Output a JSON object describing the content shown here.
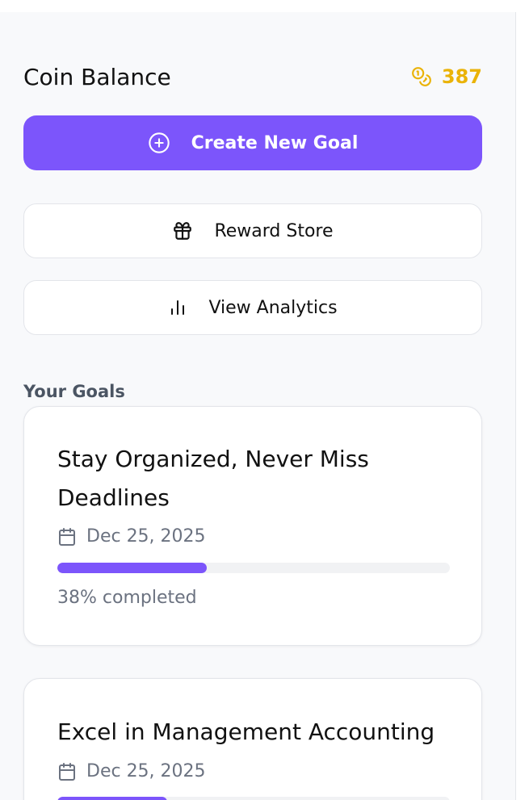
{
  "balance": {
    "title": "Coin Balance",
    "amount": "387",
    "icon": "coins-icon",
    "accent_color": "#eab308"
  },
  "actions": {
    "create_label": "Create New Goal",
    "create_icon": "plus-circle-icon",
    "store_label": "Reward Store",
    "store_icon": "gift-icon",
    "analytics_label": "View Analytics",
    "analytics_icon": "bar-chart-icon"
  },
  "goals_section": {
    "title": "Your Goals"
  },
  "goals": [
    {
      "title": "Stay Organized, Never Miss Deadlines",
      "date": "Dec 25, 2025",
      "progress": 0.38,
      "progress_label": "38% completed"
    },
    {
      "title": "Excel in Management Accounting",
      "date": "Dec 25, 2025",
      "progress": 0.28
    }
  ],
  "colors": {
    "primary": "#7c55fb",
    "coin": "#eab308"
  }
}
